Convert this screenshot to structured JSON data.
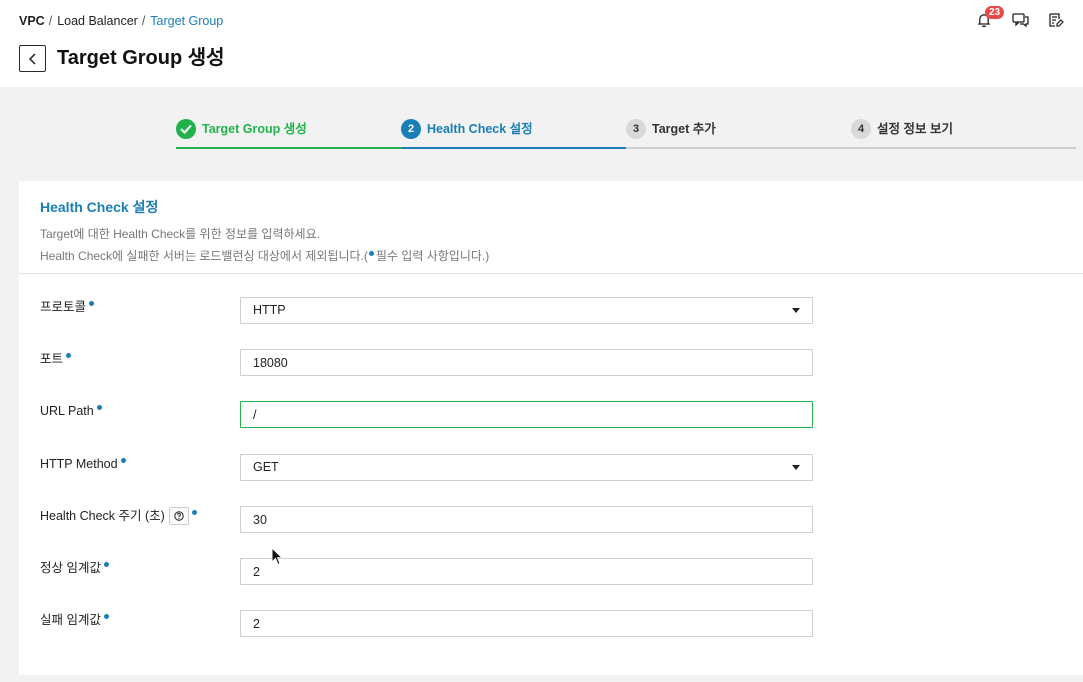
{
  "breadcrumb": [
    "VPC",
    "Load Balancer",
    "Target Group"
  ],
  "breadcrumb_sep": "/",
  "page_title": "Target Group 생성",
  "notifications": {
    "count": "23"
  },
  "steps": [
    {
      "num": "1",
      "label": "Target Group 생성",
      "state": "done"
    },
    {
      "num": "2",
      "label": "Health Check 설정",
      "state": "current"
    },
    {
      "num": "3",
      "label": "Target 추가",
      "state": "pending"
    },
    {
      "num": "4",
      "label": "설정 정보 보기",
      "state": "pending"
    }
  ],
  "section": {
    "title": "Health Check 설정",
    "desc1": "Target에 대한 Health Check를 위한 정보를 입력하세요.",
    "desc2_a": "Health Check에 실패한 서버는 로드밸런싱 대상에서 제외됩니다.(",
    "desc2_b": "필수 입력 사항입니다.)"
  },
  "form": {
    "protocol": {
      "label": "프로토콜",
      "value": "HTTP"
    },
    "port": {
      "label": "포트",
      "value": "18080"
    },
    "url_path": {
      "label": "URL Path",
      "value": "/"
    },
    "http_method": {
      "label": "HTTP Method",
      "value": "GET"
    },
    "interval": {
      "label": "Health Check 주기 (초)",
      "value": "30"
    },
    "healthy_threshold": {
      "label": "정상 임계값",
      "value": "2"
    },
    "unhealthy_threshold": {
      "label": "실패 임계값",
      "value": "2"
    }
  },
  "colors": {
    "accent": "#1a7fb5",
    "success": "#22b24c",
    "badge": "#e84a4a"
  }
}
